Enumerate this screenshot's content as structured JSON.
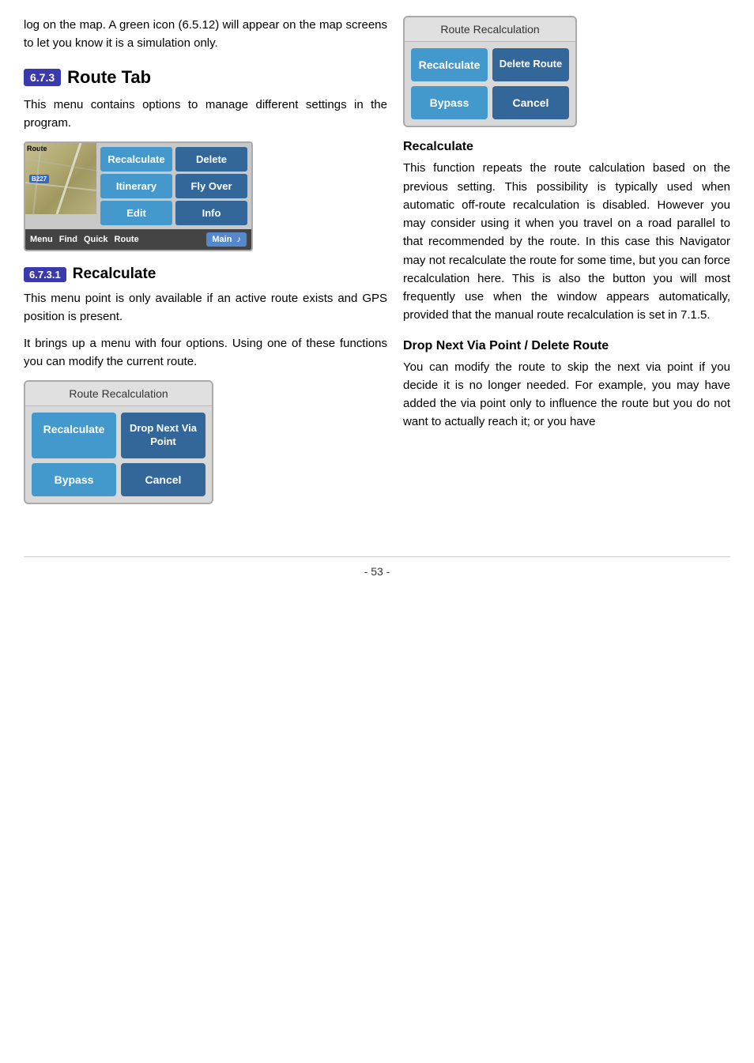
{
  "left": {
    "intro": "log on the map. A green icon (6.5.12) will appear on the map screens to let you know it is a simulation only.",
    "section_badge": "6.7.3",
    "section_title": "Route Tab",
    "section_intro1": "This menu contains options to manage different settings in the program.",
    "route_menu": {
      "btn1": "Recalculate",
      "btn2": "Delete",
      "btn3": "Itinerary",
      "btn4": "Fly Over",
      "btn5": "Edit",
      "btn6": "Info",
      "bottom_menu": "Menu",
      "bottom_find": "Find",
      "bottom_quick": "Quick",
      "bottom_route": "Route",
      "bottom_main": "Main"
    },
    "subsection_badge": "6.7.3.1",
    "subsection_title": "Recalculate",
    "subsection_p1": "This menu point is only available if an active route exists and GPS position is present.",
    "subsection_p2": "It brings up a menu with four options. Using one of these functions you can modify the current route.",
    "recalc_dialog1": {
      "title": "Route Recalculation",
      "btn1": "Recalculate",
      "btn2": "Drop Next Via Point",
      "btn3": "Bypass",
      "btn4": "Cancel"
    }
  },
  "right": {
    "recalc_dialog2": {
      "title": "Route Recalculation",
      "btn1": "Recalculate",
      "btn2": "Delete Route",
      "btn3": "Bypass",
      "btn4": "Cancel"
    },
    "recalculate_heading": "Recalculate",
    "recalculate_text": "This function repeats the route calculation based on the previous setting. This possibility is typically used when automatic off-route recalculation is disabled. However you may consider using it when you travel on a road parallel to that recommended by the route. In this case this Navigator may not recalculate the route for some time, but you can force recalculation here. This is also the button you will most frequently use when the window appears automatically, provided that the manual route recalculation is set in 7.1.5.",
    "drop_heading": "Drop Next Via Point / Delete Route",
    "drop_text": "You can modify the route to skip the next via point if you decide it is no longer needed. For example, you may have added the via point only to influence the route but you do not want to actually reach it; or you have"
  },
  "footer": {
    "page_number": "- 53 -"
  }
}
